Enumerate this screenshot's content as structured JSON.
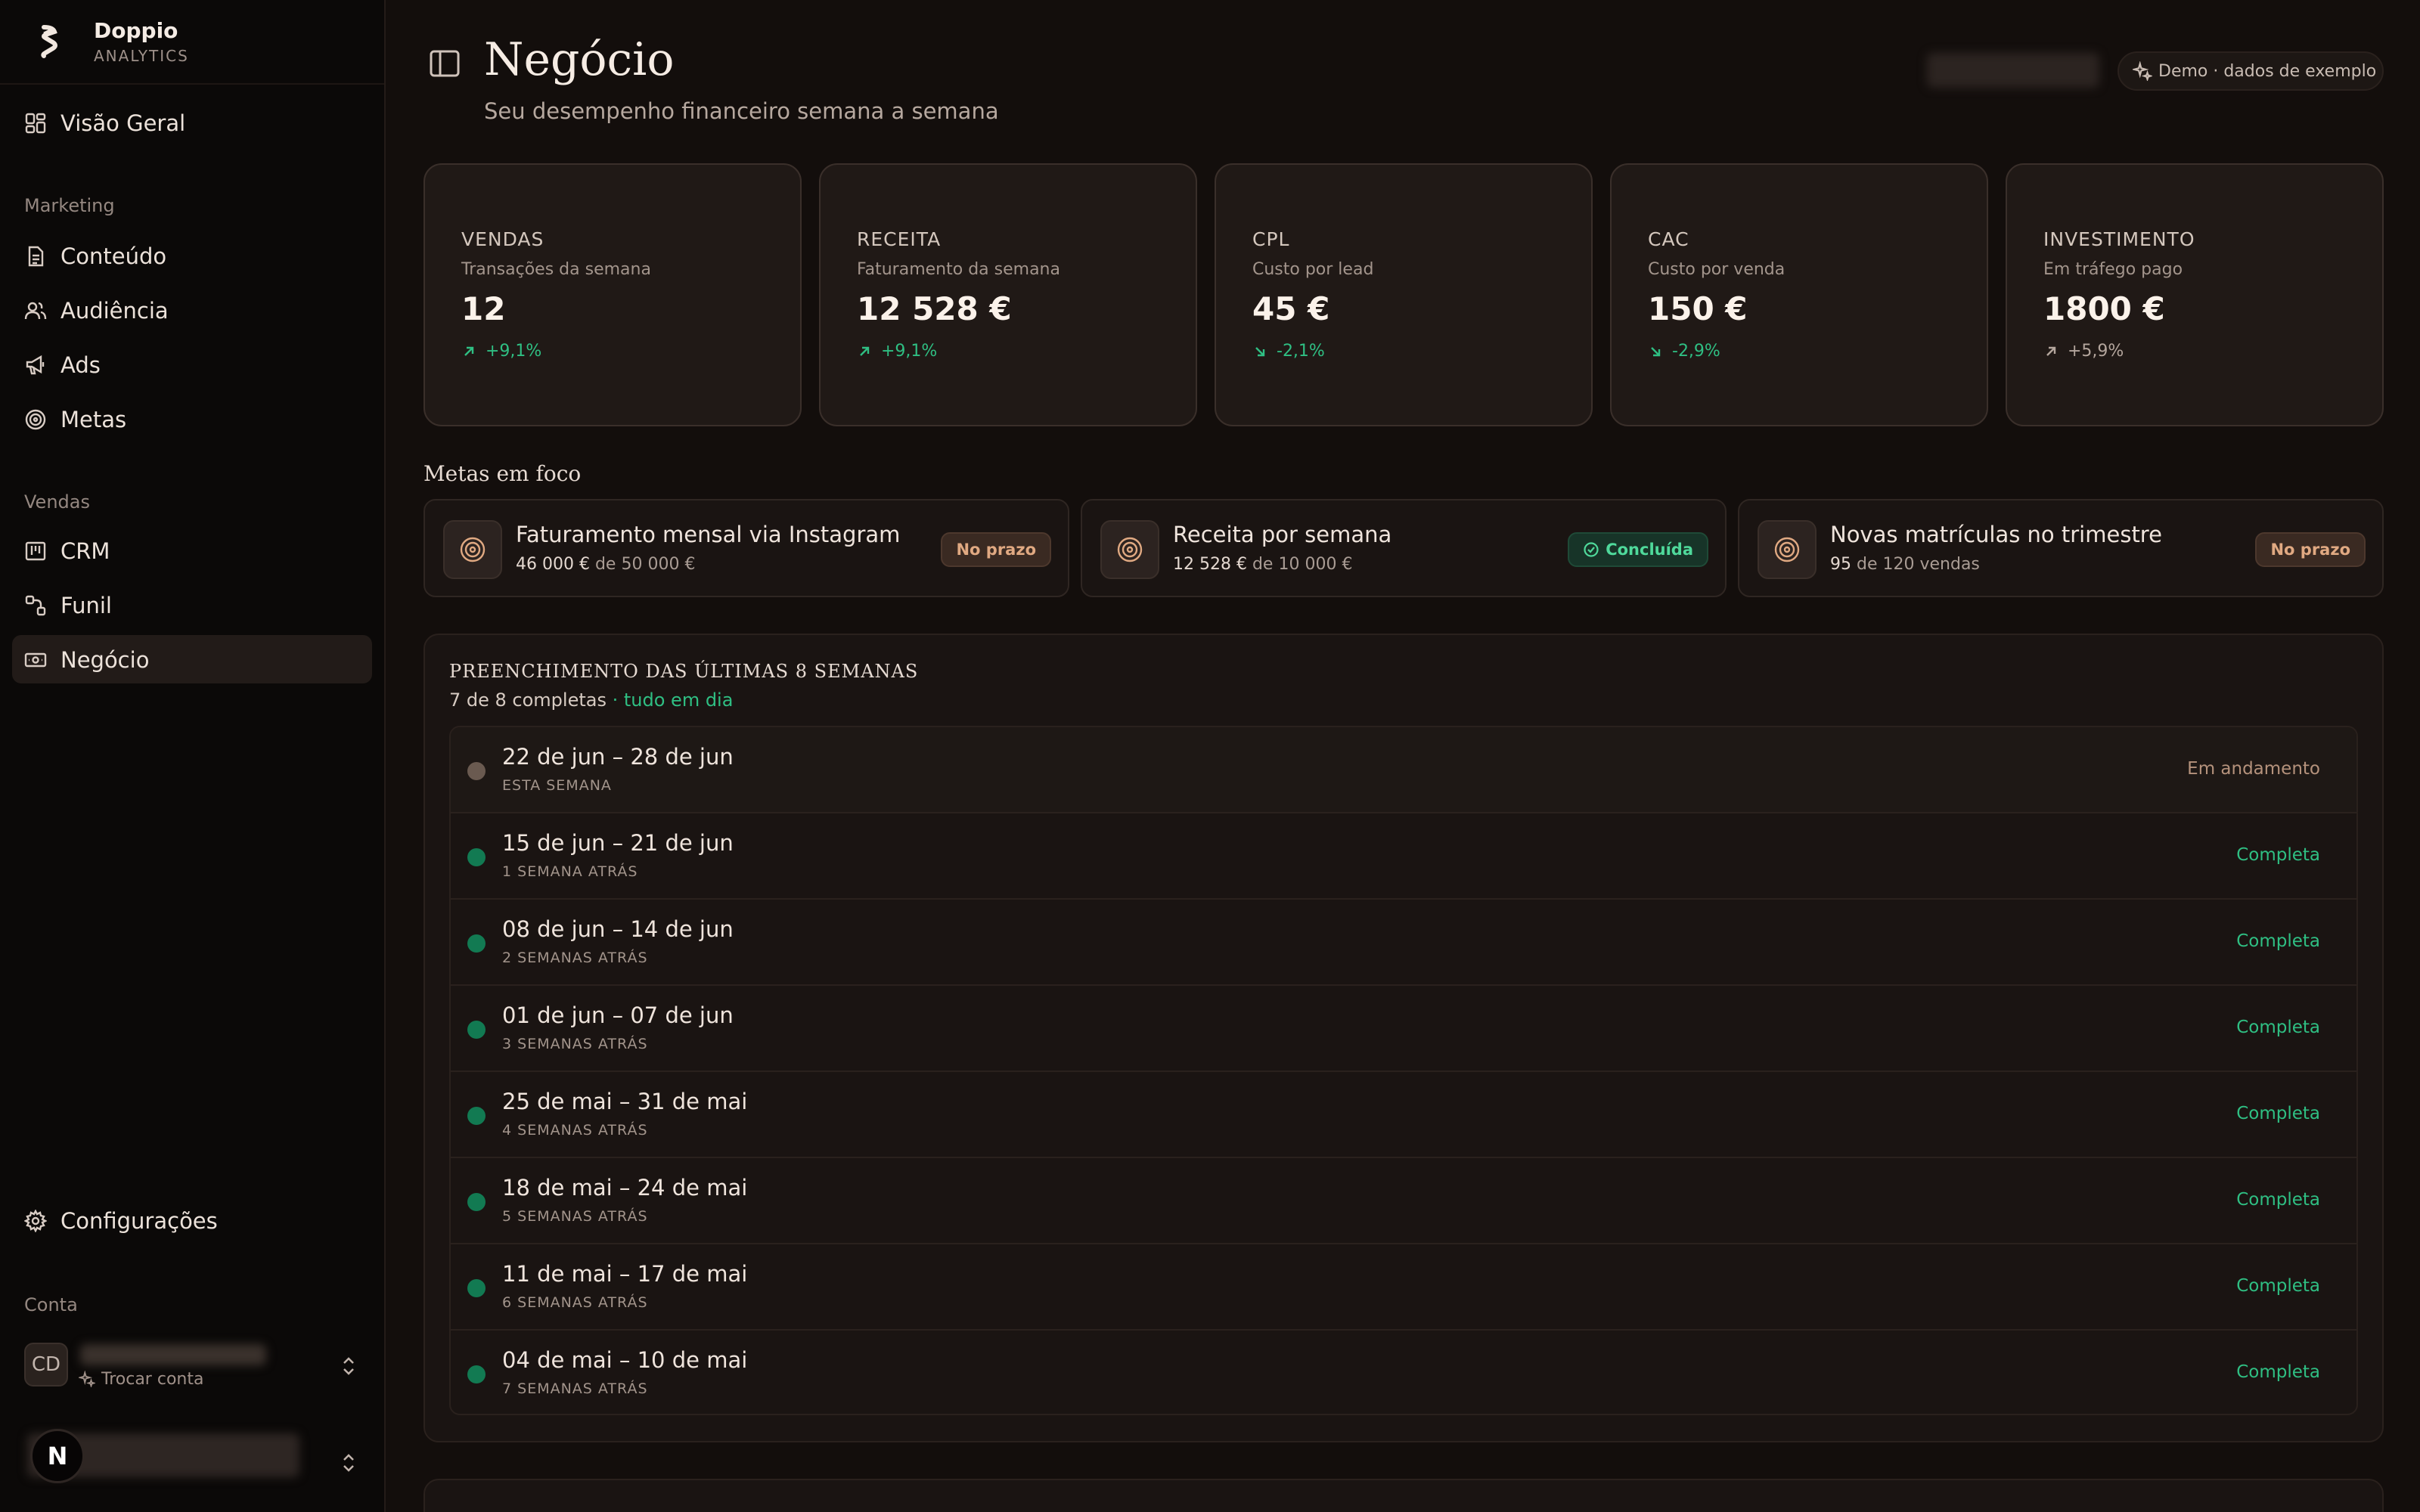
{
  "brand": {
    "name": "Doppio",
    "sub": "ANALYTICS"
  },
  "sidebar": {
    "overview": "Visão Geral",
    "marketing_label": "Marketing",
    "marketing_items": [
      "Conteúdo",
      "Audiência",
      "Ads",
      "Metas"
    ],
    "sales_label": "Vendas",
    "sales_items": [
      "CRM",
      "Funil",
      "Negócio"
    ],
    "settings": "Configurações",
    "account_label": "Conta",
    "account_initials": "CD",
    "switch_account": "Trocar conta",
    "n_badge": "N"
  },
  "header": {
    "title": "Negócio",
    "subtitle": "Seu desempenho financeiro semana a semana",
    "demo_badge": "Demo · dados de exemplo"
  },
  "kpis": [
    {
      "label": "VENDAS",
      "desc": "Transações da semana",
      "value": "12",
      "delta": "+9,1%",
      "trend": "up",
      "tone": "positive"
    },
    {
      "label": "RECEITA",
      "desc": "Faturamento da semana",
      "value": "12 528 €",
      "delta": "+9,1%",
      "trend": "up",
      "tone": "positive"
    },
    {
      "label": "CPL",
      "desc": "Custo por lead",
      "value": "45 €",
      "delta": "-2,1%",
      "trend": "down",
      "tone": "positive"
    },
    {
      "label": "CAC",
      "desc": "Custo por venda",
      "value": "150 €",
      "delta": "-2,9%",
      "trend": "down",
      "tone": "positive"
    },
    {
      "label": "INVESTIMENTO",
      "desc": "Em tráfego pago",
      "value": "1800 €",
      "delta": "+5,9%",
      "trend": "up",
      "tone": "neutral"
    }
  ],
  "goals_section": "Metas em foco",
  "goals": [
    {
      "title": "Faturamento mensal via Instagram",
      "current": "46 000 €",
      "sep": "de",
      "target": "50 000 €",
      "badge": "No prazo"
    },
    {
      "title": "Receita por semana",
      "current": "12 528 €",
      "sep": "de",
      "target": "10 000 €",
      "badge": "Concluída"
    },
    {
      "title": "Novas matrículas no trimestre",
      "current": "95",
      "sep": "de",
      "target": "120 vendas",
      "badge": "No prazo"
    }
  ],
  "weeks": {
    "title": "PREENCHIMENTO DAS ÚLTIMAS 8 SEMANAS",
    "summary": "7 de 8 completas",
    "summary_ok": "· tudo em dia",
    "rows": [
      {
        "range": "22 de jun – 28 de jun",
        "rel": "ESTA SEMANA",
        "status": "Em andamento",
        "state": "progress"
      },
      {
        "range": "15 de jun – 21 de jun",
        "rel": "1 SEMANA ATRÁS",
        "status": "Completa",
        "state": "done"
      },
      {
        "range": "08 de jun – 14 de jun",
        "rel": "2 SEMANAS ATRÁS",
        "status": "Completa",
        "state": "done"
      },
      {
        "range": "01 de jun – 07 de jun",
        "rel": "3 SEMANAS ATRÁS",
        "status": "Completa",
        "state": "done"
      },
      {
        "range": "25 de mai – 31 de mai",
        "rel": "4 SEMANAS ATRÁS",
        "status": "Completa",
        "state": "done"
      },
      {
        "range": "18 de mai – 24 de mai",
        "rel": "5 SEMANAS ATRÁS",
        "status": "Completa",
        "state": "done"
      },
      {
        "range": "11 de mai – 17 de mai",
        "rel": "6 SEMANAS ATRÁS",
        "status": "Completa",
        "state": "done"
      },
      {
        "range": "04 de mai – 10 de mai",
        "rel": "7 SEMANAS ATRÁS",
        "status": "Completa",
        "state": "done"
      }
    ]
  },
  "colors": {
    "accent_green": "#2fbf83",
    "accent_orange": "#e0a982",
    "background": "#130e0c"
  },
  "icons": [
    "logo-icon",
    "grid-icon",
    "document-icon",
    "users-icon",
    "megaphone-icon",
    "target-icon",
    "kanban-icon",
    "funnel-icon",
    "banknote-icon",
    "gear-icon",
    "sparkles-icon",
    "chevron-updown-icon",
    "sidebar-toggle-icon",
    "arrow-up-right-icon",
    "arrow-down-right-icon",
    "check-circle-icon"
  ]
}
